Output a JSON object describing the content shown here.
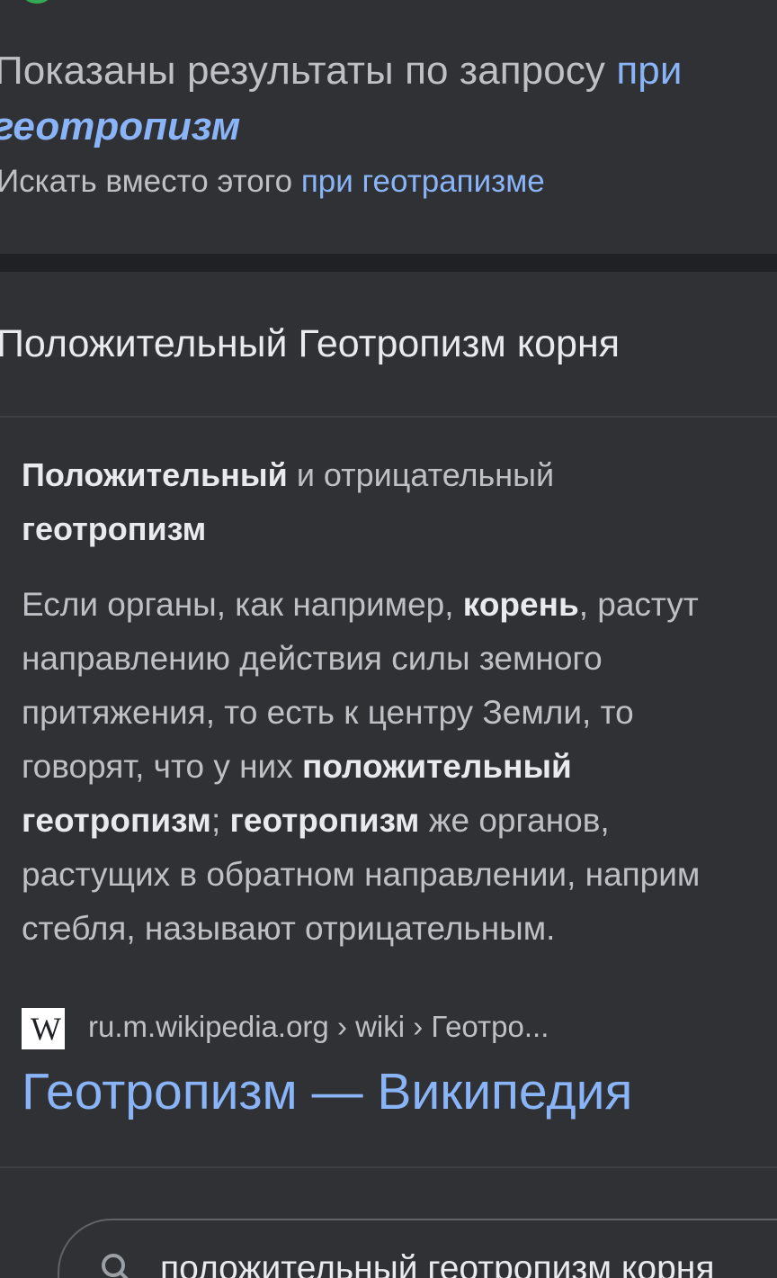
{
  "spelling": {
    "showing_prefix": "Показаны результаты по запросу ",
    "showing_link_part1": "при",
    "showing_link_part2": "геотропизм",
    "instead_prefix": "Искать вместо этого ",
    "instead_link": "при геотрапизме"
  },
  "result": {
    "header": "Положительный Геотропизм корня",
    "snippet_title_bold1": "Положительный",
    "snippet_title_mid": " и отрицательный",
    "snippet_title_bold2": "геотропизм",
    "snippet_body": {
      "l1_a": "Если органы, как например, ",
      "l1_b": "корень",
      "l1_c": ", растут",
      "l2": "направлению действия силы земного",
      "l3": "притяжения, то есть к центру Земли, то",
      "l4_a": "говорят, что у них ",
      "l4_b": "положительный",
      "l5_a": "геотропизм",
      "l5_b": "; ",
      "l5_c": "геотропизм",
      "l5_d": " же органов,",
      "l6": "растущих в обратном направлении, наприм",
      "l7": "стебля, называют отрицательным."
    },
    "source_logo": "W",
    "source_url": "ru.m.wikipedia.org › wiki › Геотро...",
    "link_title": "Геотропизм — Википедия"
  },
  "related": {
    "icon": "search-icon",
    "query": "положительный геотропизм корня"
  },
  "colors": {
    "background": "#303134",
    "link": "#8ab4f8",
    "text": "#bdc1c6",
    "text_strong": "#e8eaed"
  }
}
